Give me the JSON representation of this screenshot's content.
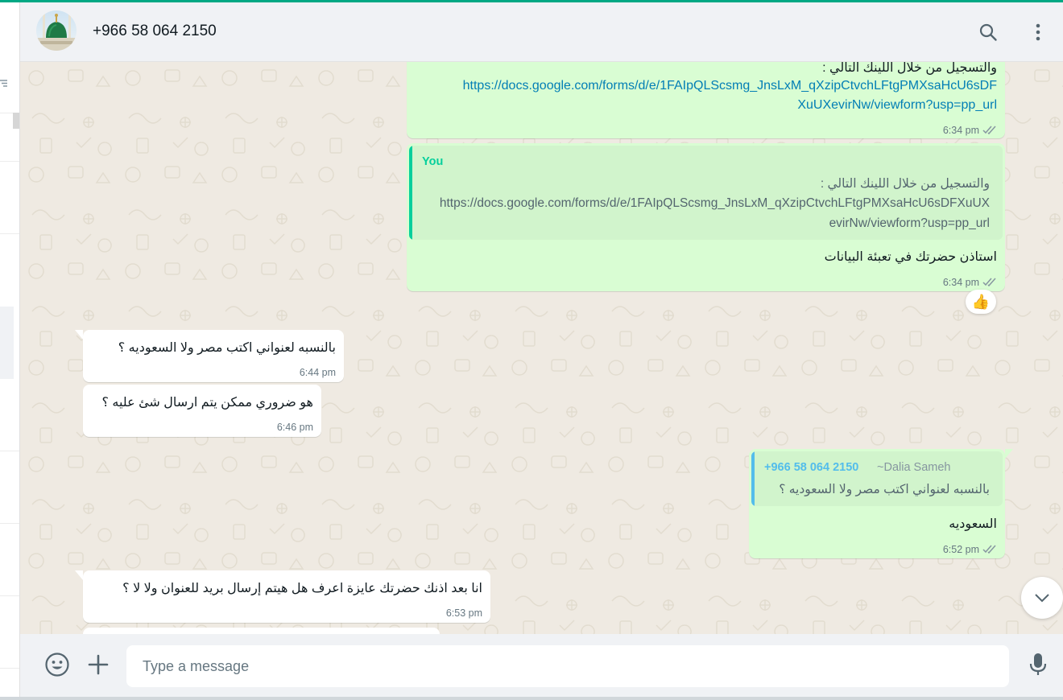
{
  "theme": {
    "accent": "#00a884",
    "outgoing_bubble": "#d9fdd3",
    "incoming_bubble": "#ffffff",
    "link_color": "#027eb5",
    "read_ticks_color": "#8696a0",
    "quote_self_author_color": "#06cf9c",
    "quote_other_author_color": "#53bdeb"
  },
  "header": {
    "contact_name": "+966 58 064 2150",
    "avatar_icon": "mosque-dome-photo",
    "search_icon": "search-icon",
    "menu_icon": "kebab-menu-icon"
  },
  "messages": [
    {
      "direction": "out",
      "line1": "والتسجيل من خلال اللينك التالي :",
      "link_line1": "https://docs.google.com/forms/d/e/1FAIpQLScsmg_JnsLxM_qXzipCtvchLFtgPMXsaHcU6sDF",
      "link_line2": "XuUXevirNw/viewform?usp=pp_url",
      "time": "6:34 pm",
      "status": "read"
    },
    {
      "direction": "out",
      "quote": {
        "author": "You",
        "line1": "والتسجيل من خلال اللينك التالي :",
        "line2": "https://docs.google.com/forms/d/e/1FAIpQLScsmg_JnsLxM_qXzipCtvchLFtgPMXsaHcU6sDFXuUX",
        "line3": "evirNw/viewform?usp=pp_url"
      },
      "text": "استاذن حضرتك في تعبئة البيانات",
      "time": "6:34 pm",
      "status": "read",
      "reaction": "👍"
    },
    {
      "direction": "in",
      "text": "بالنسبه لعنواني اكتب مصر ولا السعوديه ؟",
      "time": "6:44 pm"
    },
    {
      "direction": "in",
      "text": "هو ضروري ممكن يتم ارسال شئ عليه ؟",
      "time": "6:46 pm"
    },
    {
      "direction": "out",
      "quote": {
        "author": "+966 58 064 2150",
        "author_alias": "~Dalia Sameh",
        "line1": "بالنسبه لعنواني اكتب مصر ولا السعوديه ؟"
      },
      "text": "السعوديه",
      "time": "6:52 pm",
      "status": "read"
    },
    {
      "direction": "in",
      "text": "انا بعد اذنك حضرتك عايزة اعرف هل هيتم إرسال بريد للعنوان ولا لا ؟",
      "time": "6:53 pm"
    }
  ],
  "composer": {
    "placeholder": "Type a message",
    "emoji_icon": "emoji-icon",
    "attach_icon": "plus-icon",
    "mic_icon": "microphone-icon"
  },
  "scroll_button_icon": "chevron-down-icon"
}
